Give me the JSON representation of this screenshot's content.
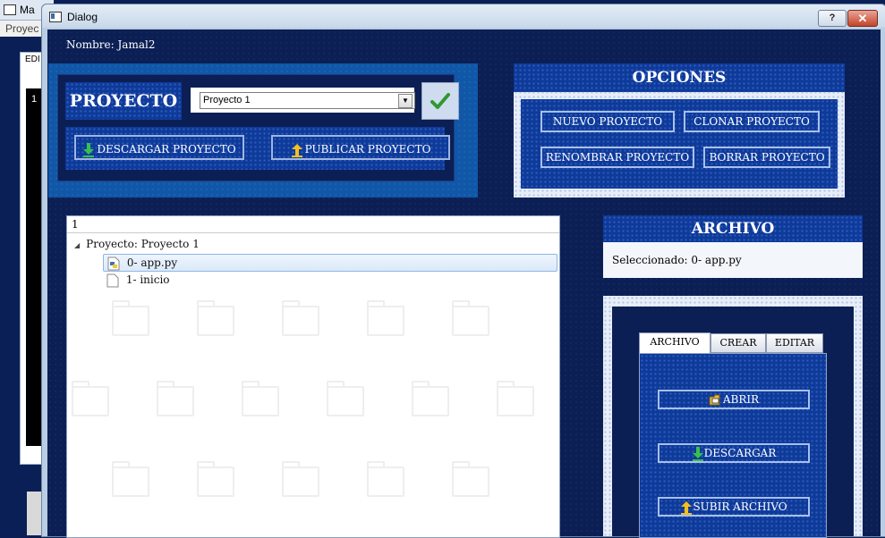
{
  "background": {
    "window_title": "Ma",
    "menu": "Proyec",
    "inner_label": "EDI",
    "line_number": "1"
  },
  "dialog": {
    "title": "Dialog",
    "help_label": "?",
    "close_label": "✕"
  },
  "nombre": "Nombre: Jamal2",
  "proyecto": {
    "label": "PROYECTO",
    "selected": "Proyecto 1",
    "descargar": "DESCARGAR PROYECTO",
    "publicar": "PUBLICAR PROYECTO"
  },
  "opciones": {
    "title": "OPCIONES",
    "nuevo": "NUEVO PROYECTO",
    "clonar": "CLONAR PROYECTO",
    "renombrar": "RENOMBRAR PROYECTO",
    "borrar": "BORRAR PROYECTO"
  },
  "tree": {
    "header": "1",
    "root": "Proyecto: Proyecto 1",
    "items": [
      {
        "label": "0- app.py",
        "icon": "python-file-icon"
      },
      {
        "label": "1- inicio",
        "icon": "file-icon"
      }
    ]
  },
  "archivo": {
    "title": "ARCHIVO",
    "seleccionado": "Seleccionado: 0- app.py",
    "tabs": [
      "ARCHIVO",
      "CREAR",
      "EDITAR"
    ],
    "abrir": "ABRIR",
    "descargar": "DESCARGAR",
    "subir": "SUBIR ARCHIVO"
  },
  "colors": {
    "dark_navy": "#0b1f55",
    "panel_blue": "#0e3a9a",
    "button_border": "#9fb6e0"
  }
}
